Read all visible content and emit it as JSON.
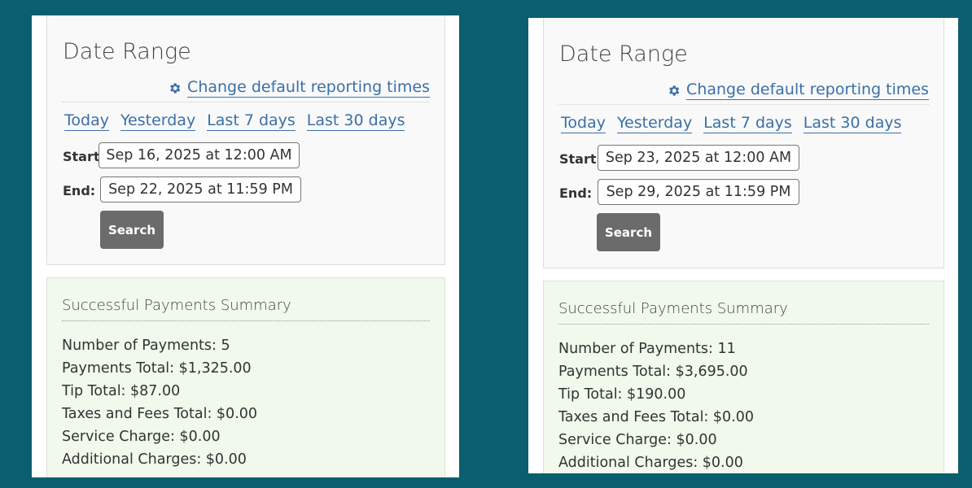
{
  "panels": [
    {
      "title": "Date Range",
      "change_default_label": "Change default reporting times",
      "quick_ranges": [
        "Today",
        "Yesterday",
        "Last 7 days",
        "Last 30 days"
      ],
      "start_label": "Start:",
      "start_value": "Sep 16, 2025 at 12:00 AM",
      "end_label": "End:",
      "end_value": "Sep 22, 2025 at 11:59 PM",
      "search_label": "Search",
      "summary": {
        "title": "Successful Payments Summary",
        "lines": [
          "Number of Payments: 5",
          "Payments Total: $1,325.00",
          "Tip Total: $87.00",
          "Taxes and Fees Total: $0.00",
          "Service Charge: $0.00",
          "Additional Charges: $0.00"
        ]
      }
    },
    {
      "title": "Date Range",
      "change_default_label": "Change default reporting times",
      "quick_ranges": [
        "Today",
        "Yesterday",
        "Last 7 days",
        "Last 30 days"
      ],
      "start_label": "Start:",
      "start_value": "Sep 23, 2025 at 12:00 AM",
      "end_label": "End:",
      "end_value": "Sep 29, 2025 at 11:59 PM",
      "search_label": "Search",
      "summary": {
        "title": "Successful Payments Summary",
        "lines": [
          "Number of Payments: 11",
          "Payments Total: $3,695.00",
          "Tip Total: $190.00",
          "Taxes and Fees Total: $0.00",
          "Service Charge: $0.00",
          "Additional Charges: $0.00"
        ]
      }
    }
  ],
  "colors": {
    "background": "#0a5f6e",
    "link": "#3b6fa7",
    "button": "#6b6b6b",
    "summary_bg": "#f0f9ec"
  },
  "icons": {
    "settings": "gear-icon"
  }
}
